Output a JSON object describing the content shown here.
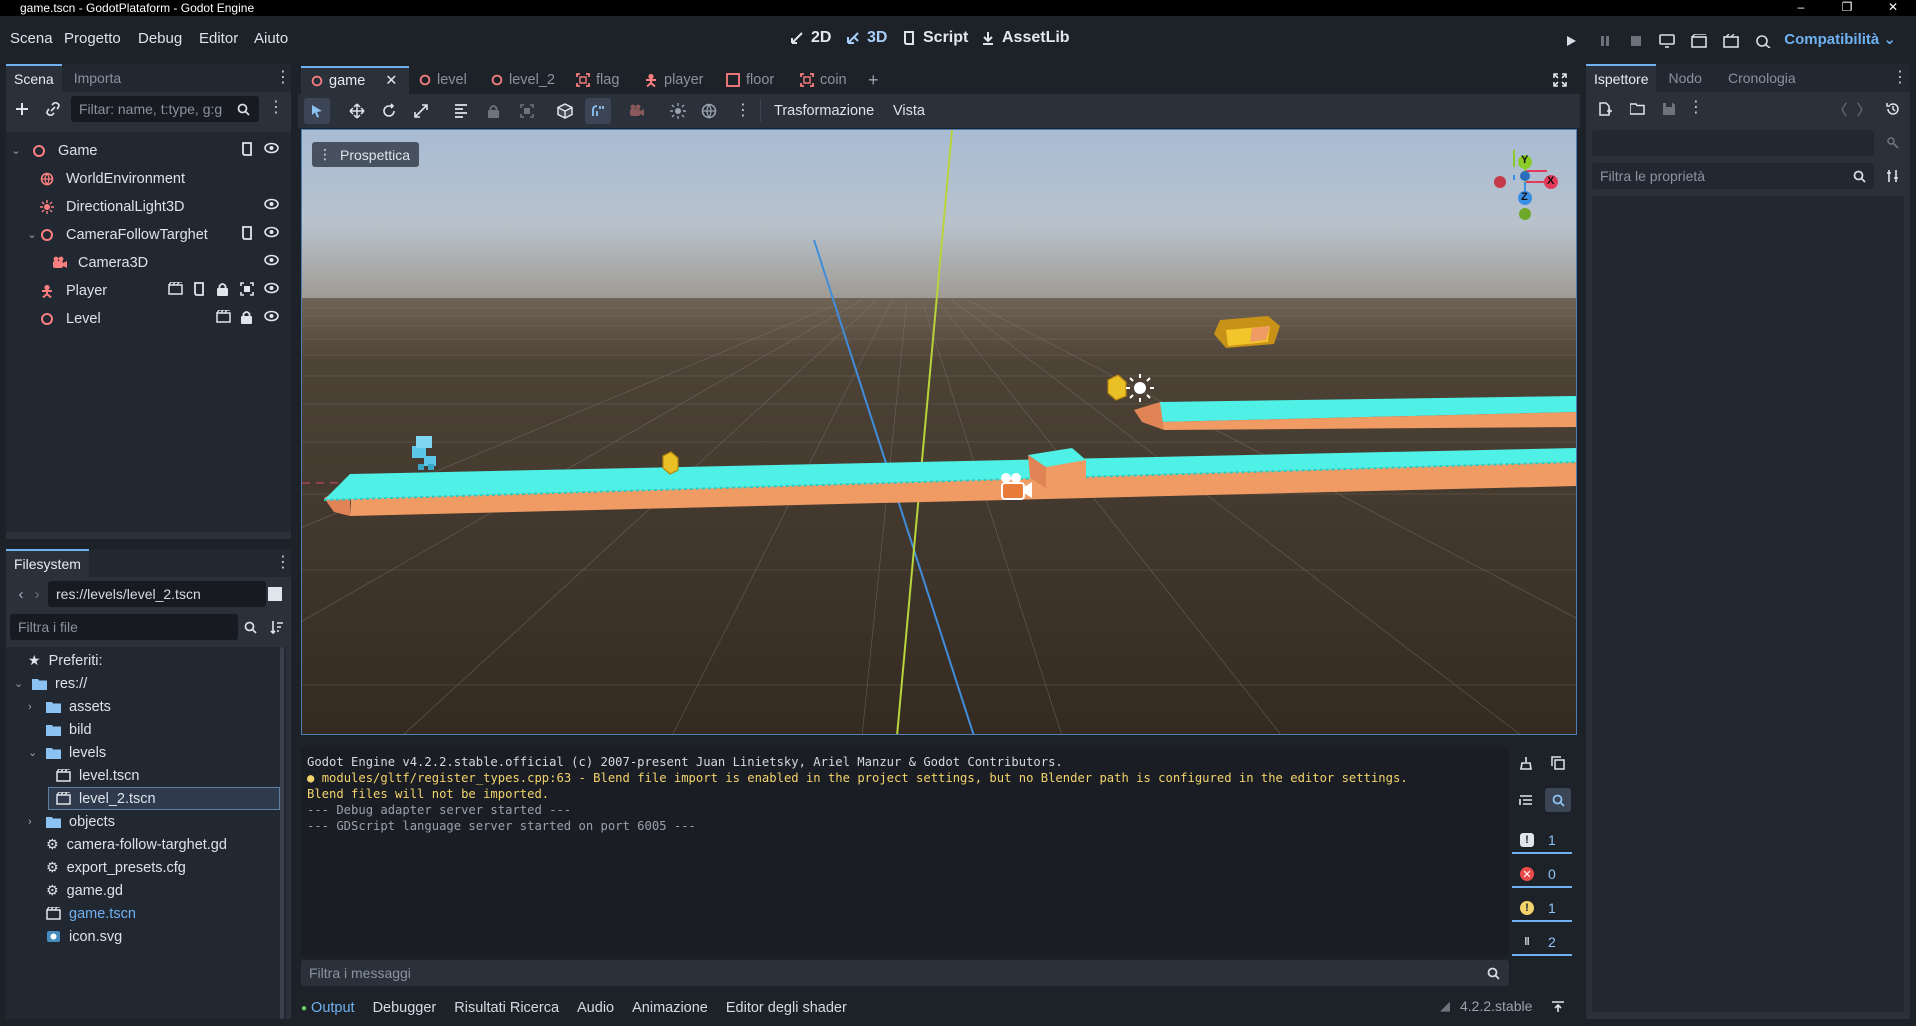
{
  "window": {
    "title": "game.tscn - GodotPlataform - Godot Engine",
    "controls": [
      "–",
      "❐",
      "✕"
    ]
  },
  "menu": [
    "Scena",
    "Progetto",
    "Debug",
    "Editor",
    "Aiuto"
  ],
  "workspaces": {
    "w2d": "2D",
    "w3d": "3D",
    "script": "Script",
    "assetlib": "AssetLib"
  },
  "renderer": "Compatibilità",
  "scene_panel": {
    "tabs": [
      "Scena",
      "Importa"
    ],
    "filter_placeholder": "Filtar: name, t:type, g:g",
    "nodes": [
      {
        "label": "Game"
      },
      {
        "label": "WorldEnvironment"
      },
      {
        "label": "DirectionalLight3D"
      },
      {
        "label": "CameraFollowTarghet"
      },
      {
        "label": "Camera3D"
      },
      {
        "label": "Player"
      },
      {
        "label": "Level"
      }
    ]
  },
  "filesystem": {
    "tab": "Filesystem",
    "path": "res://levels/level_2.tscn",
    "filter_placeholder": "Filtra i file",
    "items": [
      {
        "label": "Preferiti:"
      },
      {
        "label": "res://"
      },
      {
        "label": "assets"
      },
      {
        "label": "bild"
      },
      {
        "label": "levels"
      },
      {
        "label": "level.tscn"
      },
      {
        "label": "level_2.tscn"
      },
      {
        "label": "objects"
      },
      {
        "label": "camera-follow-targhet.gd"
      },
      {
        "label": "export_presets.cfg"
      },
      {
        "label": "game.gd"
      },
      {
        "label": "game.tscn"
      },
      {
        "label": "icon.svg"
      }
    ]
  },
  "editor_tabs": [
    "game",
    "level",
    "level_2",
    "flag",
    "player",
    "floor",
    "coin"
  ],
  "toolbar": {
    "transform": "Trasformazione",
    "view": "Vista"
  },
  "viewport": {
    "perspective_label": "Prospettica",
    "gizmo": {
      "x": "X",
      "y": "Y",
      "z": "Z"
    }
  },
  "output": {
    "lines": [
      "Godot Engine v4.2.2.stable.official (c) 2007-present Juan Linietsky, Ariel Manzur & Godot Contributors.",
      "modules/gltf/register_types.cpp:63 - Blend file import is enabled in the project settings, but no Blender path is configured in the editor settings.",
      "Blend files will not be imported.",
      "--- Debug adapter server started ---",
      "--- GDScript language server started on port 6005 ---"
    ],
    "filter_placeholder": "Filtra i messaggi",
    "counts": {
      "messages": "1",
      "errors": "0",
      "warnings": "1",
      "info": "2"
    }
  },
  "bottom_tabs": [
    "Output",
    "Debugger",
    "Risultati Ricerca",
    "Audio",
    "Animazione",
    "Editor degli shader"
  ],
  "version": "4.2.2.stable",
  "inspector": {
    "tabs": [
      "Ispettore",
      "Nodo",
      "Cronologia"
    ],
    "filter_placeholder": "Filtra le proprietà"
  },
  "colors": {
    "accent": "#6fb1f0",
    "warning": "#f3d36b",
    "node3d": "#fc7f7f",
    "platform_top": "#4ff0e6",
    "platform_side": "#f09a64"
  }
}
